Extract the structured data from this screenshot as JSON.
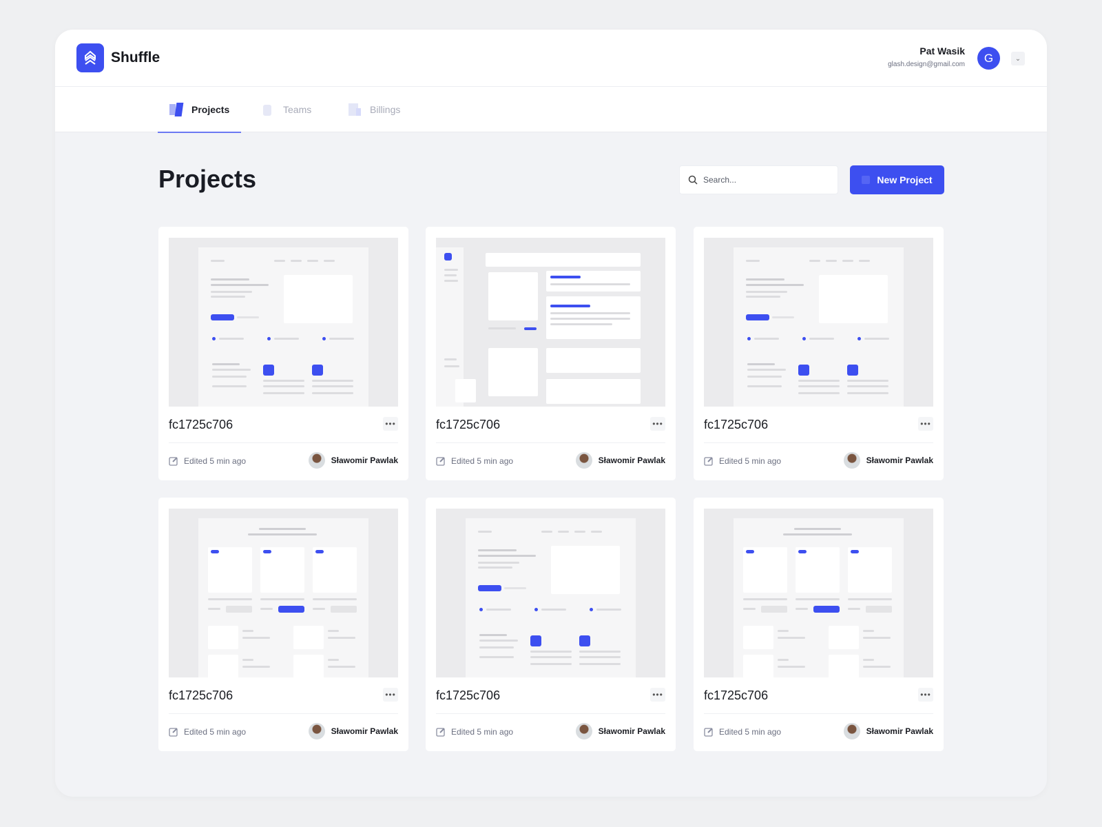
{
  "app": {
    "name": "Shuffle"
  },
  "user": {
    "name": "Pat Wasik",
    "email": "glash.design@gmail.com",
    "avatar_letter": "G"
  },
  "tabs": [
    {
      "label": "Projects",
      "active": true
    },
    {
      "label": "Teams",
      "active": false
    },
    {
      "label": "Billings",
      "active": false
    }
  ],
  "page": {
    "title": "Projects"
  },
  "search": {
    "placeholder": "Search..."
  },
  "new_project_label": "New Project",
  "colors": {
    "accent": "#3d4ff0"
  },
  "projects": [
    {
      "name": "fc1725c706",
      "edited": "Edited 5 min ago",
      "author": "Sławomir Pawlak",
      "layout": "hero"
    },
    {
      "name": "fc1725c706",
      "edited": "Edited 5 min ago",
      "author": "Sławomir Pawlak",
      "layout": "dashboard"
    },
    {
      "name": "fc1725c706",
      "edited": "Edited 5 min ago",
      "author": "Sławomir Pawlak",
      "layout": "hero"
    },
    {
      "name": "fc1725c706",
      "edited": "Edited 5 min ago",
      "author": "Sławomir Pawlak",
      "layout": "pricing"
    },
    {
      "name": "fc1725c706",
      "edited": "Edited 5 min ago",
      "author": "Sławomir Pawlak",
      "layout": "hero"
    },
    {
      "name": "fc1725c706",
      "edited": "Edited 5 min ago",
      "author": "Sławomir Pawlak",
      "layout": "pricing"
    }
  ]
}
